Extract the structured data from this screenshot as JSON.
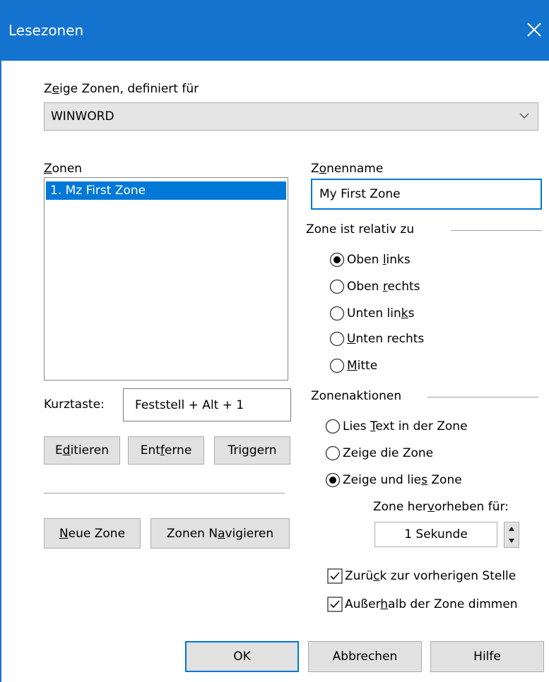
{
  "window": {
    "title": "Lesezonen"
  },
  "show_zones": {
    "label_pre": "Z",
    "label_u": "e",
    "label_post": "ige Zonen, definiert für",
    "selected": "WINWORD"
  },
  "zones": {
    "label_u": "Z",
    "label_post": "onen",
    "items": [
      "1. Mz First Zone"
    ]
  },
  "zone_name": {
    "label_pre": "Z",
    "label_u": "o",
    "label_post": "nenname",
    "value": "My First Zone"
  },
  "relative": {
    "label": "Zone ist relativ zu",
    "options": [
      {
        "pre": "Oben ",
        "u": "l",
        "post": "inks",
        "checked": true
      },
      {
        "pre": "Oben ",
        "u": "r",
        "post": "echts",
        "checked": false
      },
      {
        "pre": "Unten lin",
        "u": "k",
        "post": "s",
        "checked": false
      },
      {
        "pre": "",
        "u": "U",
        "post": "nten rechts",
        "checked": false
      },
      {
        "pre": "",
        "u": "M",
        "post": "itte",
        "checked": false
      }
    ]
  },
  "hotkey": {
    "label": "Kurztaste:",
    "value": "Feststell + Alt + 1"
  },
  "buttons": {
    "edit": {
      "pre": "E",
      "u": "d",
      "post": "itieren"
    },
    "remove": {
      "pre": "Ent",
      "u": "f",
      "post": "erne"
    },
    "trigger": {
      "pre": "Tri",
      "u": "g",
      "post": "gern"
    },
    "new_zone": {
      "pre": "",
      "u": "N",
      "post": "eue Zone"
    },
    "navigate": {
      "pre": "Zonen N",
      "u": "a",
      "post": "vigieren"
    },
    "ok": "OK",
    "cancel": "Abbrechen",
    "help": "Hilfe"
  },
  "actions": {
    "label": "Zonenaktionen",
    "options": [
      {
        "pre": "Lies ",
        "u": "T",
        "post": "ext in der Zone",
        "checked": false
      },
      {
        "pre": "Zei",
        "u": "g",
        "post": "e die Zone",
        "checked": false
      },
      {
        "pre": "Zeige und lie",
        "u": "s",
        "post": " Zone",
        "checked": true
      }
    ]
  },
  "highlight": {
    "label_pre": "Zone her",
    "label_u": "v",
    "label_post": "orheben für:",
    "value": "1 Sekunde"
  },
  "checks": [
    {
      "pre": "Zurü",
      "u": "c",
      "post": "k zur vorherigen Stelle",
      "checked": true
    },
    {
      "pre": "Außer",
      "u": "h",
      "post": "alb der Zone dimmen",
      "checked": true
    }
  ],
  "colors": {
    "titlebar": "#1473cf",
    "selection": "#0078d7"
  }
}
